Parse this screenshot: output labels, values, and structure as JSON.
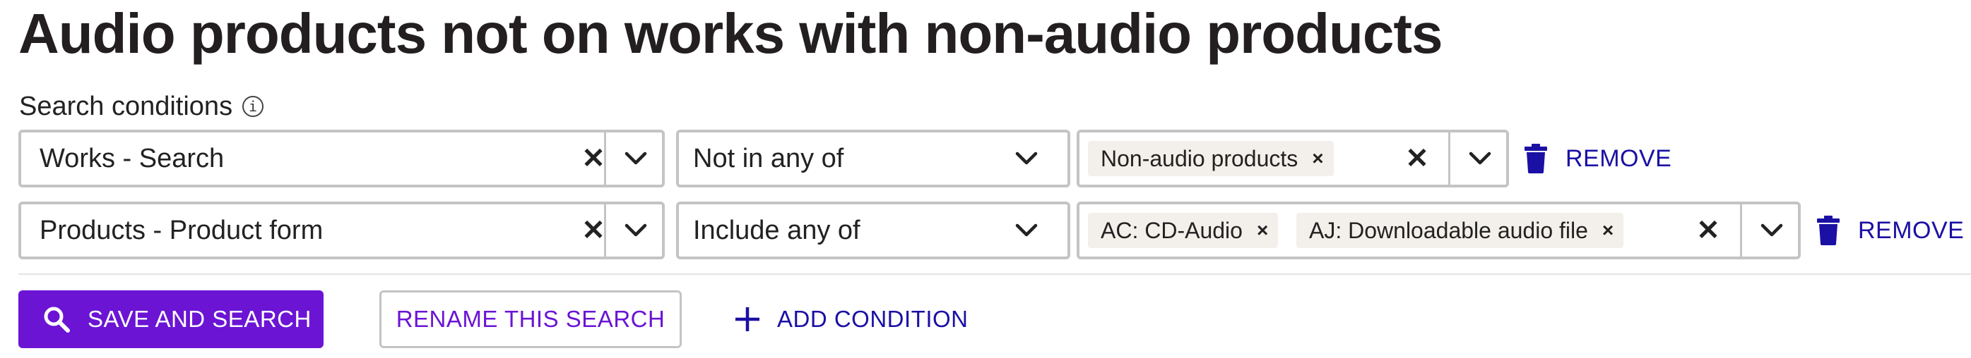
{
  "page": {
    "title": "Audio products not on works with non-audio products"
  },
  "conditions_label": "Search conditions",
  "info_glyph": "i",
  "conditions": [
    {
      "field": "Works - Search",
      "operator": "Not in any of",
      "values": [
        "Non-audio products"
      ],
      "remove_label": "REMOVE"
    },
    {
      "field": "Products - Product form",
      "operator": "Include any of",
      "values": [
        "AC: CD-Audio",
        "AJ: Downloadable audio file"
      ],
      "remove_label": "REMOVE"
    }
  ],
  "glyphs": {
    "clear": "✕",
    "chip_remove": "×"
  },
  "icons": {
    "info": "info-icon",
    "clear": "close-icon",
    "dropdown": "chevron-down-icon",
    "remove": "trash-icon",
    "search": "search-icon",
    "add": "plus-icon"
  },
  "actions": {
    "save_search": "SAVE AND SEARCH",
    "rename_search": "RENAME THIS SEARCH",
    "add_condition": "ADD CONDITION"
  },
  "colors": {
    "primary": "#6b14d4",
    "link": "#1b10a4",
    "border": "#c4c4c4",
    "chip": "#f3efea",
    "title": "#231f20"
  }
}
